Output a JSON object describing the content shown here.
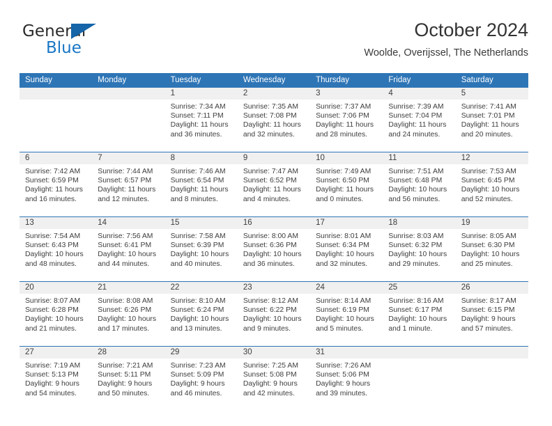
{
  "brand": {
    "word_one": "General",
    "word_two": "Blue",
    "triangle_icon": "triangle-icon",
    "accent_color": "#1877c4"
  },
  "header": {
    "title": "October 2024",
    "subtitle": "Woolde, Overijssel, The Netherlands"
  },
  "theme": {
    "header_blue": "#2e75b6",
    "band_gray": "#f0f0f0",
    "text": "#3d3d3d"
  },
  "weekdays": [
    "Sunday",
    "Monday",
    "Tuesday",
    "Wednesday",
    "Thursday",
    "Friday",
    "Saturday"
  ],
  "weeks": [
    [
      {
        "day": "",
        "sunrise": "",
        "sunset": "",
        "daylight": ""
      },
      {
        "day": "",
        "sunrise": "",
        "sunset": "",
        "daylight": ""
      },
      {
        "day": "1",
        "sunrise": "Sunrise: 7:34 AM",
        "sunset": "Sunset: 7:11 PM",
        "daylight": "Daylight: 11 hours and 36 minutes."
      },
      {
        "day": "2",
        "sunrise": "Sunrise: 7:35 AM",
        "sunset": "Sunset: 7:08 PM",
        "daylight": "Daylight: 11 hours and 32 minutes."
      },
      {
        "day": "3",
        "sunrise": "Sunrise: 7:37 AM",
        "sunset": "Sunset: 7:06 PM",
        "daylight": "Daylight: 11 hours and 28 minutes."
      },
      {
        "day": "4",
        "sunrise": "Sunrise: 7:39 AM",
        "sunset": "Sunset: 7:04 PM",
        "daylight": "Daylight: 11 hours and 24 minutes."
      },
      {
        "day": "5",
        "sunrise": "Sunrise: 7:41 AM",
        "sunset": "Sunset: 7:01 PM",
        "daylight": "Daylight: 11 hours and 20 minutes."
      }
    ],
    [
      {
        "day": "6",
        "sunrise": "Sunrise: 7:42 AM",
        "sunset": "Sunset: 6:59 PM",
        "daylight": "Daylight: 11 hours and 16 minutes."
      },
      {
        "day": "7",
        "sunrise": "Sunrise: 7:44 AM",
        "sunset": "Sunset: 6:57 PM",
        "daylight": "Daylight: 11 hours and 12 minutes."
      },
      {
        "day": "8",
        "sunrise": "Sunrise: 7:46 AM",
        "sunset": "Sunset: 6:54 PM",
        "daylight": "Daylight: 11 hours and 8 minutes."
      },
      {
        "day": "9",
        "sunrise": "Sunrise: 7:47 AM",
        "sunset": "Sunset: 6:52 PM",
        "daylight": "Daylight: 11 hours and 4 minutes."
      },
      {
        "day": "10",
        "sunrise": "Sunrise: 7:49 AM",
        "sunset": "Sunset: 6:50 PM",
        "daylight": "Daylight: 11 hours and 0 minutes."
      },
      {
        "day": "11",
        "sunrise": "Sunrise: 7:51 AM",
        "sunset": "Sunset: 6:48 PM",
        "daylight": "Daylight: 10 hours and 56 minutes."
      },
      {
        "day": "12",
        "sunrise": "Sunrise: 7:53 AM",
        "sunset": "Sunset: 6:45 PM",
        "daylight": "Daylight: 10 hours and 52 minutes."
      }
    ],
    [
      {
        "day": "13",
        "sunrise": "Sunrise: 7:54 AM",
        "sunset": "Sunset: 6:43 PM",
        "daylight": "Daylight: 10 hours and 48 minutes."
      },
      {
        "day": "14",
        "sunrise": "Sunrise: 7:56 AM",
        "sunset": "Sunset: 6:41 PM",
        "daylight": "Daylight: 10 hours and 44 minutes."
      },
      {
        "day": "15",
        "sunrise": "Sunrise: 7:58 AM",
        "sunset": "Sunset: 6:39 PM",
        "daylight": "Daylight: 10 hours and 40 minutes."
      },
      {
        "day": "16",
        "sunrise": "Sunrise: 8:00 AM",
        "sunset": "Sunset: 6:36 PM",
        "daylight": "Daylight: 10 hours and 36 minutes."
      },
      {
        "day": "17",
        "sunrise": "Sunrise: 8:01 AM",
        "sunset": "Sunset: 6:34 PM",
        "daylight": "Daylight: 10 hours and 32 minutes."
      },
      {
        "day": "18",
        "sunrise": "Sunrise: 8:03 AM",
        "sunset": "Sunset: 6:32 PM",
        "daylight": "Daylight: 10 hours and 29 minutes."
      },
      {
        "day": "19",
        "sunrise": "Sunrise: 8:05 AM",
        "sunset": "Sunset: 6:30 PM",
        "daylight": "Daylight: 10 hours and 25 minutes."
      }
    ],
    [
      {
        "day": "20",
        "sunrise": "Sunrise: 8:07 AM",
        "sunset": "Sunset: 6:28 PM",
        "daylight": "Daylight: 10 hours and 21 minutes."
      },
      {
        "day": "21",
        "sunrise": "Sunrise: 8:08 AM",
        "sunset": "Sunset: 6:26 PM",
        "daylight": "Daylight: 10 hours and 17 minutes."
      },
      {
        "day": "22",
        "sunrise": "Sunrise: 8:10 AM",
        "sunset": "Sunset: 6:24 PM",
        "daylight": "Daylight: 10 hours and 13 minutes."
      },
      {
        "day": "23",
        "sunrise": "Sunrise: 8:12 AM",
        "sunset": "Sunset: 6:22 PM",
        "daylight": "Daylight: 10 hours and 9 minutes."
      },
      {
        "day": "24",
        "sunrise": "Sunrise: 8:14 AM",
        "sunset": "Sunset: 6:19 PM",
        "daylight": "Daylight: 10 hours and 5 minutes."
      },
      {
        "day": "25",
        "sunrise": "Sunrise: 8:16 AM",
        "sunset": "Sunset: 6:17 PM",
        "daylight": "Daylight: 10 hours and 1 minute."
      },
      {
        "day": "26",
        "sunrise": "Sunrise: 8:17 AM",
        "sunset": "Sunset: 6:15 PM",
        "daylight": "Daylight: 9 hours and 57 minutes."
      }
    ],
    [
      {
        "day": "27",
        "sunrise": "Sunrise: 7:19 AM",
        "sunset": "Sunset: 5:13 PM",
        "daylight": "Daylight: 9 hours and 54 minutes."
      },
      {
        "day": "28",
        "sunrise": "Sunrise: 7:21 AM",
        "sunset": "Sunset: 5:11 PM",
        "daylight": "Daylight: 9 hours and 50 minutes."
      },
      {
        "day": "29",
        "sunrise": "Sunrise: 7:23 AM",
        "sunset": "Sunset: 5:09 PM",
        "daylight": "Daylight: 9 hours and 46 minutes."
      },
      {
        "day": "30",
        "sunrise": "Sunrise: 7:25 AM",
        "sunset": "Sunset: 5:08 PM",
        "daylight": "Daylight: 9 hours and 42 minutes."
      },
      {
        "day": "31",
        "sunrise": "Sunrise: 7:26 AM",
        "sunset": "Sunset: 5:06 PM",
        "daylight": "Daylight: 9 hours and 39 minutes."
      },
      {
        "day": "",
        "sunrise": "",
        "sunset": "",
        "daylight": ""
      },
      {
        "day": "",
        "sunrise": "",
        "sunset": "",
        "daylight": ""
      }
    ]
  ]
}
